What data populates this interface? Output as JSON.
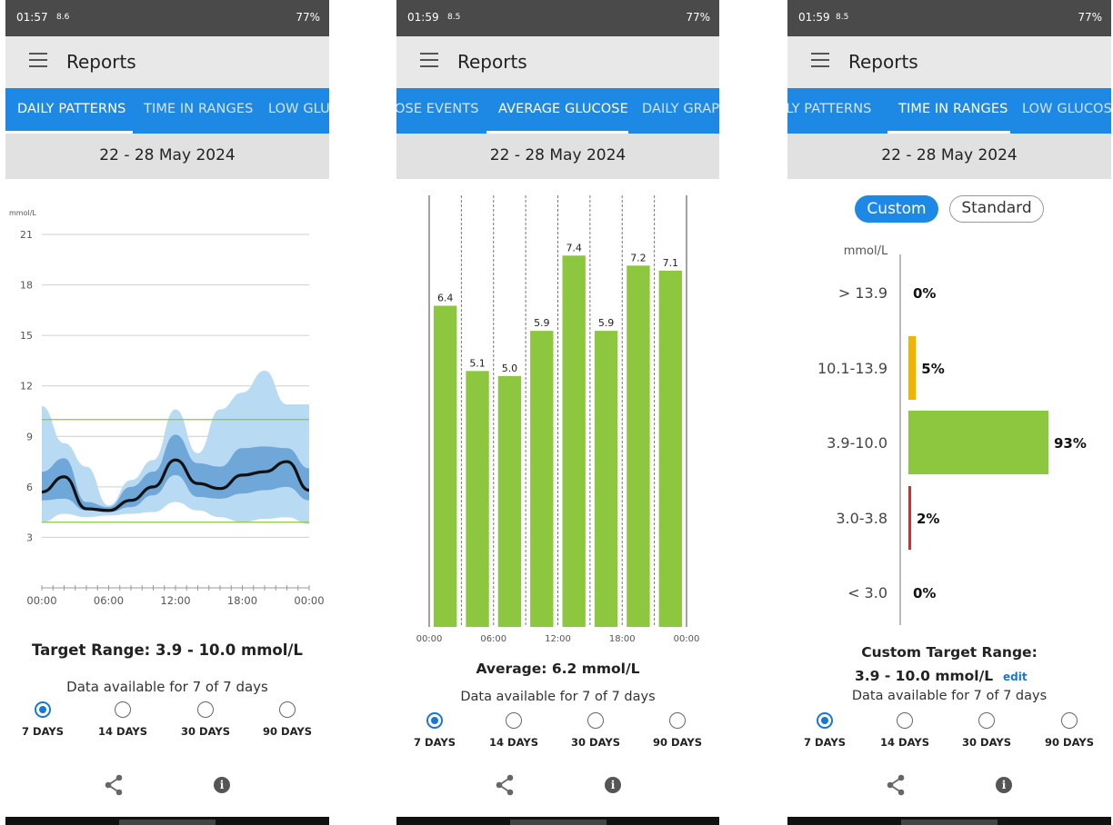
{
  "screens": [
    {
      "status": {
        "time": "01:57",
        "left_extra": "8.6",
        "right": "77%"
      },
      "title": "Reports",
      "tabs": [
        "DAILY PATTERNS",
        "TIME IN RANGES",
        "LOW GLUC"
      ],
      "date_range": "22 - 28 May 2024",
      "chart_unit": "mmol/L",
      "y_ticks": [
        "21",
        "18",
        "15",
        "12",
        "9",
        "6",
        "3"
      ],
      "x_ticks": [
        "00:00",
        "06:00",
        "12:00",
        "18:00",
        "00:00"
      ],
      "target_range_text": "Target Range: 3.9 - 10.0 mmol/L",
      "availability": "Data available for 7 of 7 days",
      "periods": [
        "7 DAYS",
        "14 DAYS",
        "30 DAYS",
        "90 DAYS"
      ]
    },
    {
      "status": {
        "time": "01:59",
        "left_extra": "8.5",
        "right": "77%"
      },
      "title": "Reports",
      "tabs": [
        "OSE EVENTS",
        "AVERAGE GLUCOSE",
        "DAILY GRAPH"
      ],
      "date_range": "22 - 28 May 2024",
      "x_ticks": [
        "00:00",
        "06:00",
        "12:00",
        "18:00",
        "00:00"
      ],
      "average_text": "Average: 6.2 mmol/L",
      "availability": "Data available for 7 of 7 days",
      "periods": [
        "7 DAYS",
        "14 DAYS",
        "30 DAYS",
        "90 DAYS"
      ]
    },
    {
      "status": {
        "time": "01:59",
        "left_extra": "8.5",
        "right": "77%"
      },
      "title": "Reports",
      "tabs": [
        "ILY PATTERNS",
        "TIME IN RANGES",
        "LOW GLUCOSE"
      ],
      "date_range": "22 - 28 May 2024",
      "toggle": {
        "custom": "Custom",
        "standard": "Standard"
      },
      "unit": "mmol/L",
      "custom_title": "Custom Target Range:",
      "custom_range": "3.9 - 10.0 mmol/L",
      "edit": "edit",
      "availability": "Data available for 7 of 7 days",
      "periods": [
        "7 DAYS",
        "14 DAYS",
        "30 DAYS",
        "90 DAYS"
      ]
    }
  ],
  "chart_data": [
    {
      "type": "line",
      "unit": "mmol/L",
      "x": [
        "00:00",
        "02:00",
        "04:00",
        "06:00",
        "08:00",
        "10:00",
        "12:00",
        "14:00",
        "16:00",
        "18:00",
        "20:00",
        "22:00",
        "24:00"
      ],
      "series": [
        {
          "values": [
            5.7,
            6.6,
            4.7,
            4.6,
            5.2,
            6.0,
            7.6,
            6.2,
            5.9,
            6.7,
            6.9,
            7.5,
            5.8
          ]
        }
      ],
      "target_range": [
        3.9,
        10.0
      ],
      "ylim": [
        0,
        21
      ],
      "xlim": [
        "00:00",
        "24:00"
      ],
      "grid": true
    },
    {
      "type": "bar",
      "categories": [
        "00:00-03:00",
        "03:00-06:00",
        "06:00-09:00",
        "09:00-12:00",
        "12:00-15:00",
        "15:00-18:00",
        "18:00-21:00",
        "21:00-24:00"
      ],
      "values": [
        6.4,
        5.1,
        5.0,
        5.9,
        7.4,
        5.9,
        7.2,
        7.1
      ],
      "x_ticks": [
        "00:00",
        "06:00",
        "12:00",
        "18:00",
        "00:00"
      ],
      "color": "#8dc63f"
    },
    {
      "type": "bar",
      "categories": [
        "> 13.9",
        "10.1-13.9",
        "3.9-10.0",
        "3.0-3.8",
        "< 3.0"
      ],
      "values": [
        0,
        5,
        93,
        2,
        0
      ],
      "labels": [
        "0%",
        "5%",
        "93%",
        "2%",
        "0%"
      ],
      "colors": [
        "#f0b400",
        "#f0b400",
        "#8dc63f",
        "#d32f2f",
        "#d32f2f"
      ],
      "ylabel": "mmol/L"
    }
  ]
}
